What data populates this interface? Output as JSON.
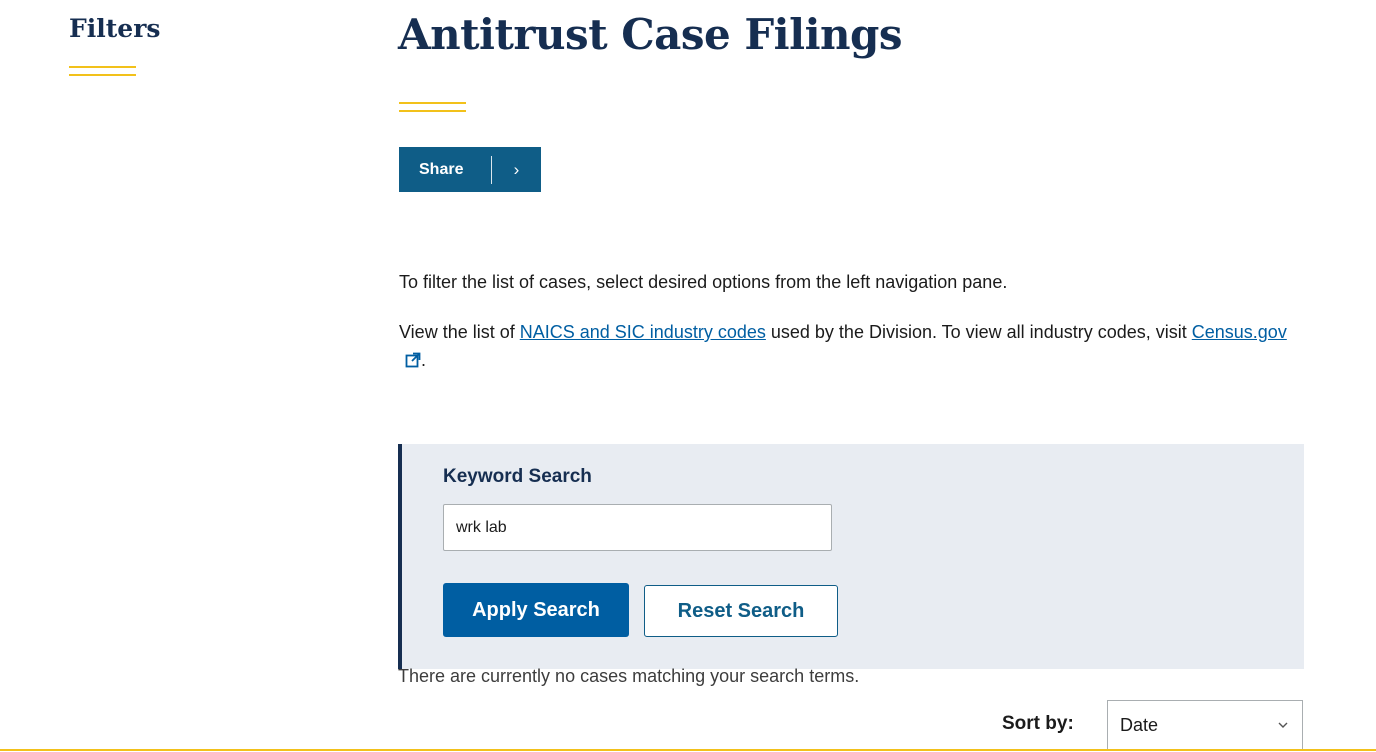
{
  "sidebar": {
    "title": "Filters"
  },
  "main": {
    "title": "Antitrust Case Filings",
    "share": {
      "label": "Share",
      "chevron": "›"
    },
    "intro_text": "To filter the list of cases, select desired options from the left navigation pane.",
    "codes_text_1": "View the list of",
    "codes_link": "NAICS and SIC industry codes",
    "codes_text_2": "used by the Division. To view all industry codes, visit",
    "census_link": "Census.gov",
    "codes_text_end": "."
  },
  "search": {
    "label": "Keyword Search",
    "value": "wrk lab",
    "apply_label": "Apply Search",
    "reset_label": "Reset Search",
    "no_results": "There are currently no cases matching your search terms."
  },
  "sort": {
    "label": "Sort by:",
    "selected": "Date"
  },
  "colors": {
    "navy": "#162e51",
    "gold": "#f2c11a",
    "primary": "#005ea2",
    "share_bg": "#0f5d87",
    "panel_bg": "#e8ecf2"
  },
  "icons": {
    "external_link": "external-link-icon",
    "sort_chevron": "chevron-down-icon",
    "share_chevron": "chevron-right-icon"
  }
}
